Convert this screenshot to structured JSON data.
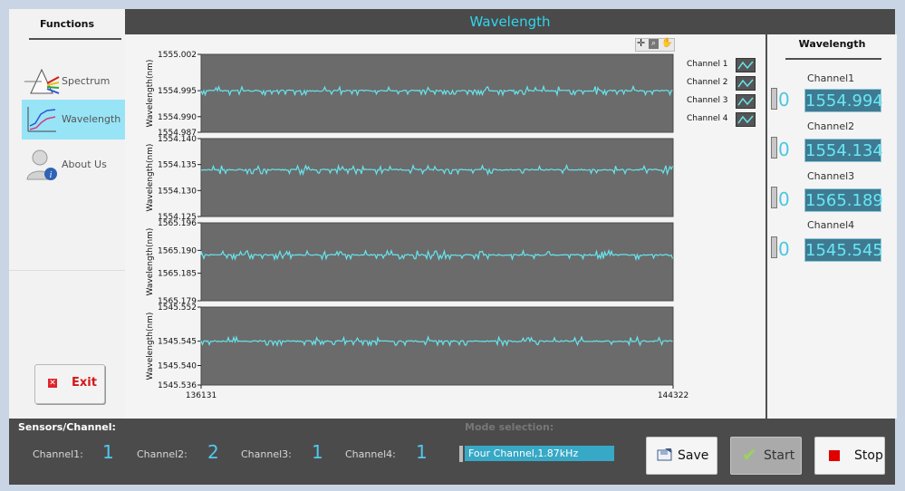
{
  "sidebar": {
    "title": "Functions",
    "items": [
      {
        "label": "Spectrum"
      },
      {
        "label": "Wavelength"
      },
      {
        "label": "About Us"
      }
    ],
    "exit_label": "Exit"
  },
  "window_title": "Wavelength",
  "chart_data": [
    {
      "type": "line",
      "ylabel": "Wavelength(nm)",
      "xlim": [
        136131,
        144322
      ],
      "x_ticks": [
        "136131",
        "144322"
      ],
      "ylim": [
        1554.987,
        1555.002
      ],
      "y_ticks": [
        "1555.002",
        "1554.995",
        "1554.990",
        "1554.987"
      ],
      "series": [
        {
          "name": "Channel 1",
          "approx_value": 1554.995,
          "color": "#67e5ee"
        }
      ]
    },
    {
      "type": "line",
      "ylabel": "Wavelength(nm)",
      "xlim": [
        136131,
        144322
      ],
      "ylim": [
        1554.125,
        1554.14
      ],
      "y_ticks": [
        "1554.140",
        "1554.135",
        "1554.130",
        "1554.125"
      ],
      "series": [
        {
          "name": "Channel 2",
          "approx_value": 1554.134,
          "color": "#67e5ee"
        }
      ]
    },
    {
      "type": "line",
      "ylabel": "Wavelength(nm)",
      "xlim": [
        136131,
        144322
      ],
      "ylim": [
        1565.179,
        1565.196
      ],
      "y_ticks": [
        "1565.196",
        "1565.190",
        "1565.185",
        "1565.179"
      ],
      "series": [
        {
          "name": "Channel 3",
          "approx_value": 1565.189,
          "color": "#67e5ee"
        }
      ]
    },
    {
      "type": "line",
      "ylabel": "Wavelength(nm)",
      "xlim": [
        136131,
        144322
      ],
      "ylim": [
        1545.536,
        1545.552
      ],
      "y_ticks": [
        "1545.552",
        "1545.545",
        "1545.540",
        "1545.536"
      ],
      "series": [
        {
          "name": "Channel 4",
          "approx_value": 1545.545,
          "color": "#67e5ee"
        }
      ]
    }
  ],
  "legend": [
    "Channel 1",
    "Channel 2",
    "Channel 3",
    "Channel 4"
  ],
  "right_panel": {
    "title": "Wavelength",
    "channels": [
      {
        "label": "Channel1",
        "zero": "0",
        "value": "1554.994"
      },
      {
        "label": "Channel2",
        "zero": "0",
        "value": "1554.134"
      },
      {
        "label": "Channel3",
        "zero": "0",
        "value": "1565.189"
      },
      {
        "label": "Channel4",
        "zero": "0",
        "value": "1545.545"
      }
    ]
  },
  "bottom": {
    "sensors_title": "Sensors/Channel:",
    "channels": [
      {
        "label": "Channel1:",
        "value": "1"
      },
      {
        "label": "Channel2:",
        "value": "2"
      },
      {
        "label": "Channel3:",
        "value": "1"
      },
      {
        "label": "Channel4:",
        "value": "1"
      }
    ],
    "mode_title": "Mode selection:",
    "mode_value": "Four Channel,1.87kHz",
    "save_label": "Save",
    "start_label": "Start",
    "stop_label": "Stop"
  },
  "colors": {
    "accent": "#2fd6ef",
    "plot_bg": "#6b6b6b",
    "trace": "#67e5ee",
    "stop_red": "#e00000"
  }
}
